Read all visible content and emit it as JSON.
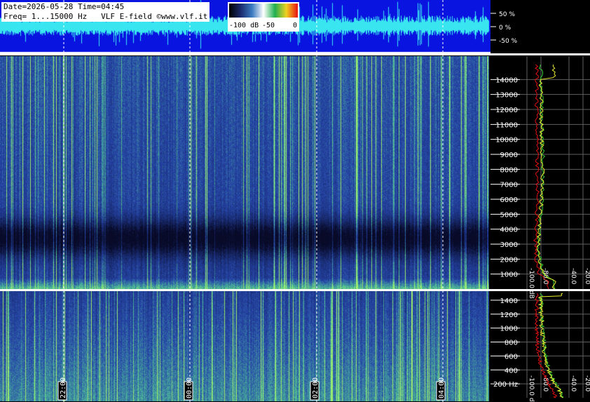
{
  "header": {
    "line1": "Date=2026-05-28 Time=04:45",
    "line2": "Freq= 1...15000 Hz   VLF E-field ©www.vlf.it"
  },
  "colorbar": {
    "tick_labels": [
      "-100 dB",
      "-50",
      "0"
    ],
    "tick_values": [
      -100,
      -50,
      0
    ],
    "range": [
      -100,
      0
    ],
    "colors": [
      "#000000",
      "#1a2a6c",
      "#3a7ac0",
      "#ffffff",
      "#20b050",
      "#f0d020",
      "#e81010"
    ]
  },
  "colors": {
    "background": "#000000",
    "waveform_bg": "#0a14e0",
    "waveform_trace": "#39e6f0",
    "spectrogram_low": "#0b1038",
    "spectrogram_mid": "#2a4a9a",
    "spectrogram_high": "#7fe0a0",
    "spectrum_green": "#33cc33",
    "spectrum_yellow": "#e8e830",
    "spectrum_red": "#e01010",
    "grid": "#606060"
  },
  "chart_data": [
    {
      "type": "line",
      "name": "waveform",
      "ylabel_ticks": [
        "50 %",
        "0 %",
        "-50 %"
      ],
      "ytick_values": [
        50,
        0,
        -50
      ],
      "ylim": [
        -100,
        100
      ]
    },
    {
      "type": "heatmap",
      "name": "spectrogram-full",
      "x_tick_labels": [
        "22:00",
        "00:00",
        "02:00",
        "04:00"
      ],
      "ylim": [
        0,
        15000
      ],
      "y_tick_labels": [
        "1000",
        "2000",
        "3000",
        "4000",
        "5000",
        "6000",
        "7000",
        "8000",
        "9000",
        "10000",
        "11000",
        "12000",
        "13000",
        "14000"
      ],
      "y_tick_values": [
        1000,
        2000,
        3000,
        4000,
        5000,
        6000,
        7000,
        8000,
        9000,
        10000,
        11000,
        12000,
        13000,
        14000
      ],
      "spectrum": {
        "x_tick_labels": [
          "-100.0 dB",
          "-80.0",
          "-40.0",
          "-20.0"
        ],
        "x_tick_values": [
          -100,
          -80,
          -40,
          -20
        ],
        "xlim": [
          -110,
          -10
        ],
        "series": [
          {
            "color": "green",
            "freq": [
              500,
              1000,
              2000,
              3000,
              4000,
              5000,
              6000,
              7000,
              8000,
              9000,
              10000,
              11000,
              12000,
              13000,
              14000
            ],
            "db": [
              -60,
              -75,
              -82,
              -83,
              -82,
              -80,
              -78,
              -78,
              -77,
              -77,
              -78,
              -78,
              -79,
              -79,
              -80
            ]
          },
          {
            "color": "red",
            "freq": [
              500,
              1000,
              2000,
              3000,
              4000,
              5000,
              6000,
              7000,
              8000,
              9000,
              10000,
              11000,
              12000,
              13000,
              14000
            ],
            "db": [
              -70,
              -83,
              -87,
              -88,
              -87,
              -86,
              -85,
              -85,
              -85,
              -85,
              -85,
              -86,
              -86,
              -86,
              -86
            ]
          }
        ]
      }
    },
    {
      "type": "heatmap",
      "name": "spectrogram-low",
      "x_tick_labels": [
        "22:00",
        "00:00",
        "02:00",
        "04:00"
      ],
      "ylim": [
        0,
        1500
      ],
      "y_tick_labels": [
        "200 Hz",
        "400",
        "600",
        "800",
        "1000",
        "1200",
        "1400"
      ],
      "y_tick_values": [
        200,
        400,
        600,
        800,
        1000,
        1200,
        1400
      ],
      "spectrum": {
        "x_tick_labels": [
          "-100.0 dB",
          "-80.0",
          "-40.0",
          "-20.0"
        ],
        "x_tick_values": [
          -100,
          -80,
          -40,
          -20
        ],
        "xlim": [
          -110,
          -10
        ],
        "series": [
          {
            "color": "green",
            "freq": [
              50,
              150,
              250,
              350,
              450,
              550,
              650,
              750,
              850,
              950,
              1050,
              1150,
              1250,
              1350,
              1450
            ],
            "db": [
              -50,
              -55,
              -62,
              -66,
              -70,
              -72,
              -74,
              -75,
              -76,
              -77,
              -78,
              -78,
              -79,
              -79,
              -80
            ]
          },
          {
            "color": "red",
            "freq": [
              50,
              150,
              250,
              350,
              450,
              550,
              650,
              750,
              850,
              950,
              1050,
              1150,
              1250,
              1350,
              1450
            ],
            "db": [
              -60,
              -65,
              -72,
              -76,
              -80,
              -82,
              -84,
              -85,
              -85,
              -86,
              -86,
              -86,
              -86,
              -86,
              -86
            ]
          }
        ]
      }
    }
  ]
}
